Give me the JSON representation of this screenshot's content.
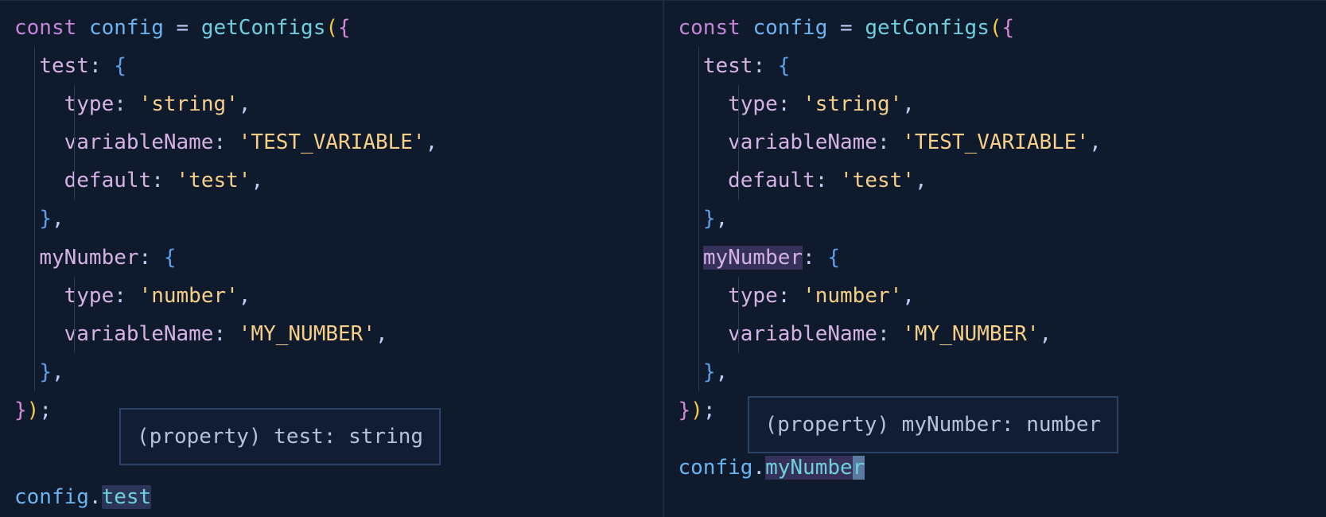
{
  "left": {
    "code": {
      "kw": "const",
      "varName": "config",
      "eq": " = ",
      "fn": "getConfigs",
      "op1": "(",
      "op2": "{",
      "test_key": "test",
      "colon": ": ",
      "string_lit": "'string'",
      "vname_key": "variableName",
      "vname_val": "'TEST_VARIABLE'",
      "default_key": "default",
      "default_val": "'test'",
      "mynum_key": "myNumber",
      "number_lit": "'number'",
      "vname2_val": "'MY_NUMBER'",
      "type_key": "type",
      "comma": ",",
      "cb": "}",
      "cp": ")",
      "semi": ";"
    },
    "tooltip": "(property) test: string",
    "last_obj": "config",
    "last_dot": ".",
    "last_prop": "test"
  },
  "right": {
    "code": {
      "kw": "const",
      "varName": "config",
      "eq": " = ",
      "fn": "getConfigs",
      "op1": "(",
      "op2": "{",
      "test_key": "test",
      "colon": ": ",
      "string_lit": "'string'",
      "vname_key": "variableName",
      "vname_val": "'TEST_VARIABLE'",
      "default_key": "default",
      "default_val": "'test'",
      "mynum_key": "myNumber",
      "number_lit": "'number'",
      "vname2_val": "'MY_NUMBER'",
      "type_key": "type",
      "comma": ",",
      "cb": "}",
      "cp": ")",
      "semi": ";"
    },
    "tooltip": "(property) myNumber: number",
    "last_obj": "config",
    "last_dot": ".",
    "last_prop_pre": "myNumbe",
    "last_prop_char": "r"
  }
}
